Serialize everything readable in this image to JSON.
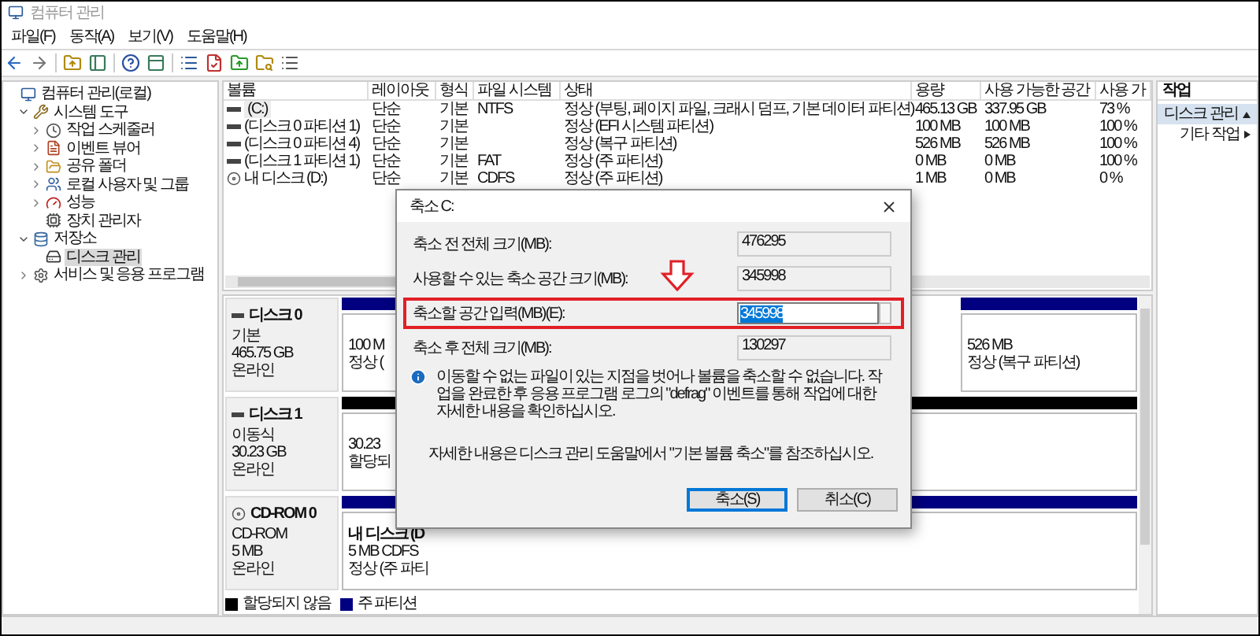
{
  "window": {
    "title": "컴퓨터 관리"
  },
  "menu": [
    "파일(F)",
    "동작(A)",
    "보기(V)",
    "도움말(H)"
  ],
  "tree": [
    {
      "label": "컴퓨터 관리(로컬)",
      "kind": "computer",
      "selected": false,
      "children": [
        {
          "label": "시스템 도구",
          "kind": "tools",
          "expanded": true,
          "selected": false,
          "children": [
            {
              "label": "작업 스케줄러",
              "kind": "clock",
              "expanded": false,
              "selected": false
            },
            {
              "label": "이벤트 뷰어",
              "kind": "viewer",
              "expanded": false,
              "selected": false
            },
            {
              "label": "공유 폴더",
              "kind": "share",
              "expanded": false,
              "selected": false
            },
            {
              "label": "로컬 사용자 및 그룹",
              "kind": "users",
              "expanded": false,
              "selected": false
            },
            {
              "label": "성능",
              "kind": "gauge",
              "expanded": false,
              "selected": false
            },
            {
              "label": "장치 관리자",
              "kind": "device",
              "selected": false
            }
          ]
        },
        {
          "label": "저장소",
          "kind": "storage",
          "expanded": true,
          "selected": false,
          "children": [
            {
              "label": "디스크 관리",
              "kind": "disk",
              "selected": true
            }
          ]
        },
        {
          "label": "서비스 및 응용 프로그램",
          "kind": "services",
          "expanded": false,
          "selected": false
        }
      ]
    }
  ],
  "volumes": {
    "columns": [
      "볼륨",
      "레이아웃",
      "형식",
      "파일 시스템",
      "상태",
      "용량",
      "사용 가능한 공간",
      "사용 가"
    ],
    "rows": [
      {
        "kind": "disk",
        "selected": true,
        "cells": [
          "(C:)",
          "단순",
          "기본",
          "NTFS",
          "정상 (부팅, 페이지 파일, 크래시 덤프, 기본 데이터 파티션)",
          "465.13 GB",
          "337.95 GB",
          "73 %"
        ]
      },
      {
        "kind": "disk",
        "selected": false,
        "cells": [
          "(디스크 0 파티션 1)",
          "단순",
          "기본",
          "",
          "정상 (EFI 시스템 파티션)",
          "100 MB",
          "100 MB",
          "100 %"
        ]
      },
      {
        "kind": "disk",
        "selected": false,
        "cells": [
          "(디스크 0 파티션 4)",
          "단순",
          "기본",
          "",
          "정상 (복구 파티션)",
          "526 MB",
          "526 MB",
          "100 %"
        ]
      },
      {
        "kind": "disk",
        "selected": false,
        "cells": [
          "(디스크 1 파티션 1)",
          "단순",
          "기본",
          "FAT",
          "정상 (주 파티션)",
          "0 MB",
          "0 MB",
          "100 %"
        ]
      },
      {
        "kind": "cdrom",
        "selected": false,
        "cells": [
          "내 디스크 (D:)",
          "단순",
          "기본",
          "CDFS",
          "정상 (주 파티션)",
          "1 MB",
          "0 MB",
          "0 %"
        ]
      }
    ]
  },
  "disks": [
    {
      "kind": "disk",
      "name": "디스크 0",
      "type": "기본",
      "size": "465.75 GB",
      "status": "온라인",
      "partitions": [
        {
          "color": "#000080",
          "lines": [
            "100 M",
            "정상 ("
          ]
        },
        {
          "color": "#000080",
          "lines": [
            "526 MB",
            "정상 (복구 파티션)"
          ]
        }
      ]
    },
    {
      "kind": "disk",
      "name": "디스크 1",
      "type": "이동식",
      "size": "30.23 GB",
      "status": "온라인",
      "partitions": [
        {
          "color": "#000000",
          "lines": [
            "30.23",
            "할당되"
          ]
        }
      ]
    },
    {
      "kind": "cdrom",
      "name": "CD-ROM 0",
      "type": "CD-ROM",
      "size": "5 MB",
      "status": "온라인",
      "partitions": [
        {
          "color": "#000080",
          "lines": [
            "내 디스크 (D",
            "5 MB CDFS",
            "정상 (주 파티"
          ]
        }
      ]
    }
  ],
  "legend": [
    {
      "label": "할당되지 않음",
      "color": "#000000"
    },
    {
      "label": "주 파티션",
      "color": "#000080"
    }
  ],
  "actions": {
    "header": "작업",
    "items": [
      {
        "label": "디스크 관리",
        "kind": "section"
      },
      {
        "label": "기타 작업",
        "kind": "submenu"
      }
    ]
  },
  "dialog": {
    "title": "축소 C:",
    "fields": [
      {
        "label": "축소 전 전체 크기(MB):",
        "value": "476295",
        "kind": "readonly",
        "highlighted": false
      },
      {
        "label": "사용할 수 있는 축소 공간 크기(MB):",
        "value": "345998",
        "kind": "readonly",
        "highlighted": false
      },
      {
        "label": "축소할 공간 입력(MB)(E):",
        "value": "345998",
        "kind": "spin",
        "highlighted": true
      },
      {
        "label": "축소 후 전체 크기(MB):",
        "value": "130297",
        "kind": "readonly",
        "highlighted": false
      }
    ],
    "info": "이동할 수 없는 파일이 있는 지점을 벗어나 볼륨을 축소할 수 없습니다. 작업을 완료한 후 응용 프로그램 로그의 \"defrag\" 이벤트를 통해 작업에 대한 자세한 내용을 확인하십시오.",
    "help": "자세한 내용은 디스크 관리 도움말에서 \"기본 볼륨 축소\"를 참조하십시오.",
    "buttons": [
      {
        "label": "축소(S)",
        "default": true
      },
      {
        "label": "취소(C)",
        "default": false
      }
    ]
  }
}
